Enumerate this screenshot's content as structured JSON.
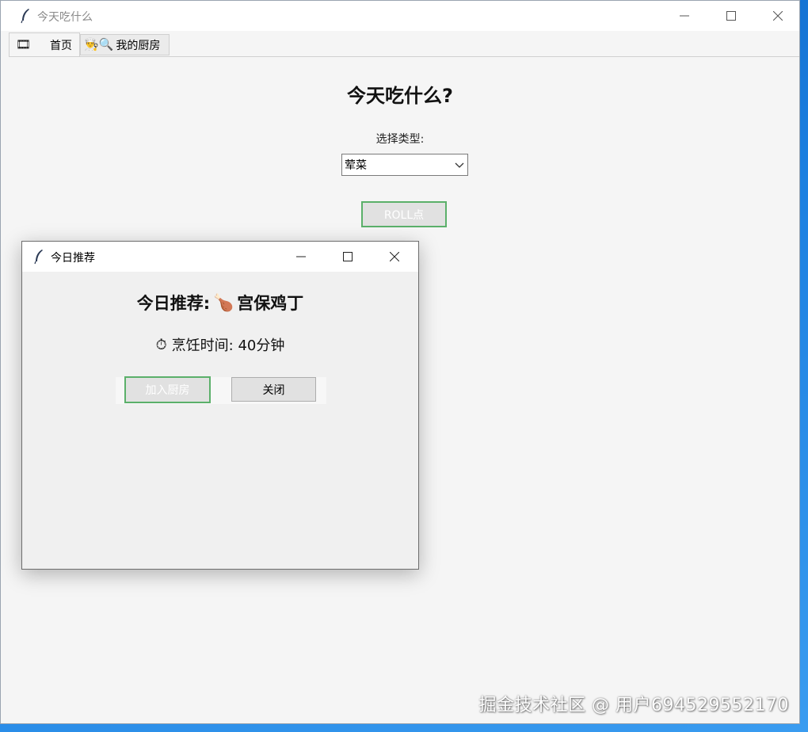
{
  "window": {
    "title": "今天吃什么"
  },
  "tabs": [
    {
      "icon": "🎞",
      "label": "首页"
    },
    {
      "icon": "👨‍🍳🔍",
      "label": "我的厨房"
    }
  ],
  "main": {
    "heading": "今天吃什么?",
    "type_label": "选择类型:",
    "type_value": "荤菜",
    "roll_button": "ROLL点"
  },
  "popup": {
    "title": "今日推荐",
    "recommend_prefix": "今日推荐:",
    "dish_icon": "🍗",
    "dish_name": "宫保鸡丁",
    "timer_icon": "⏱",
    "cook_time": "烹饪时间: 40分钟",
    "add_button": "加入厨房",
    "close_button": "关闭"
  },
  "watermark": "掘金技术社区 @ 用户694529552170",
  "colors": {
    "accent_border": "#5bb06a",
    "desktop": "#1b7fe0"
  }
}
